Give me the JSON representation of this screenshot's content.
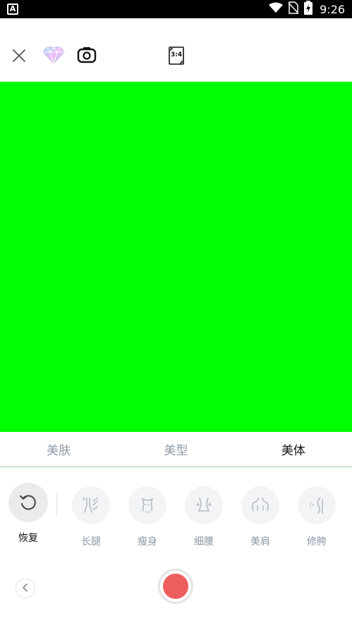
{
  "status_bar": {
    "app_glyph": "A",
    "time": "9:26",
    "icons": [
      "wifi-icon",
      "no-sim-icon",
      "battery-charging-icon"
    ]
  },
  "toolbar": {
    "aspect_ratio": "3:4",
    "icons": [
      "close-icon",
      "diamond-icon",
      "camera-switch-icon",
      "aspect-ratio-icon"
    ]
  },
  "preview": {
    "color": "#00ff00"
  },
  "tabs": [
    {
      "label": "美肤",
      "active": false
    },
    {
      "label": "美型",
      "active": false
    },
    {
      "label": "美体",
      "active": true
    }
  ],
  "tools": {
    "reset_label": "恢复",
    "items": [
      {
        "label": "长腿",
        "icon": "long-legs-icon"
      },
      {
        "label": "瘦身",
        "icon": "slim-body-icon"
      },
      {
        "label": "细腰",
        "icon": "thin-waist-icon"
      },
      {
        "label": "美肩",
        "icon": "shoulder-icon"
      },
      {
        "label": "修胯",
        "icon": "hip-icon"
      }
    ]
  },
  "colors": {
    "accent_active_tab": "#111111",
    "inactive_tab": "#8f9aa6",
    "shutter": "#ef5e5e",
    "tab_underline": "#9ad29a"
  }
}
